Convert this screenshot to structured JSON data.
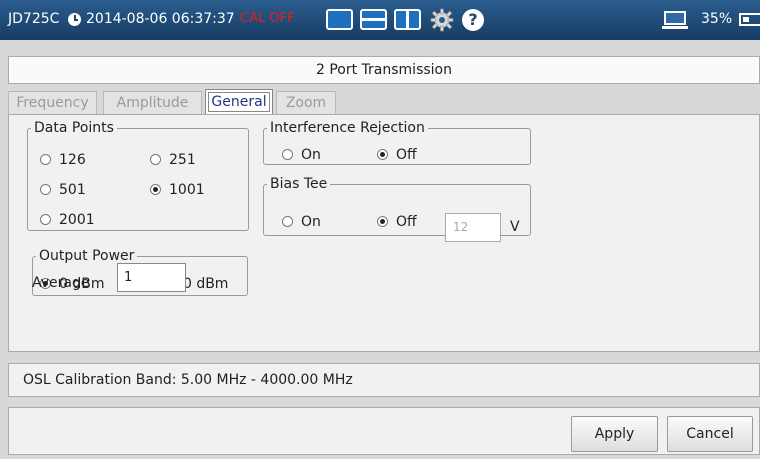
{
  "status_bar": {
    "model": "JD725C",
    "datetime": "2014-08-06 06:37:37",
    "cal_state": "CAL OFF",
    "battery_percent": "35%",
    "icons": [
      "clock-icon",
      "single-view-icon",
      "horizontal-split-icon",
      "vertical-split-icon",
      "gear-icon",
      "help-icon",
      "monitor-icon",
      "battery-icon"
    ]
  },
  "dialog": {
    "title": "2 Port Transmission",
    "tabs": [
      {
        "label": "Frequency",
        "active": false
      },
      {
        "label": "Amplitude",
        "active": false
      },
      {
        "label": "General",
        "active": true
      },
      {
        "label": "Zoom",
        "active": false
      }
    ],
    "data_points": {
      "legend": "Data Points",
      "options": [
        {
          "label": "126",
          "selected": false
        },
        {
          "label": "251",
          "selected": false
        },
        {
          "label": "501",
          "selected": false
        },
        {
          "label": "1001",
          "selected": true
        },
        {
          "label": "2001",
          "selected": false
        }
      ]
    },
    "interference_rejection": {
      "legend": "Interference Rejection",
      "options": [
        {
          "label": "On",
          "selected": false
        },
        {
          "label": "Off",
          "selected": true
        }
      ]
    },
    "bias_tee": {
      "legend": "Bias Tee",
      "options": [
        {
          "label": "On",
          "selected": false
        },
        {
          "label": "Off",
          "selected": true
        }
      ],
      "voltage_value": "12",
      "voltage_unit": "V"
    },
    "output_power": {
      "legend": "Output Power",
      "options": [
        {
          "label": "0 dBm",
          "selected": true
        },
        {
          "label": "-30 dBm",
          "selected": false
        }
      ]
    },
    "average": {
      "label": "Average",
      "value": "1"
    },
    "osl_calibration": "OSL Calibration Band: 5.00 MHz - 4000.00 MHz",
    "buttons": {
      "apply": "Apply",
      "cancel": "Cancel"
    }
  }
}
